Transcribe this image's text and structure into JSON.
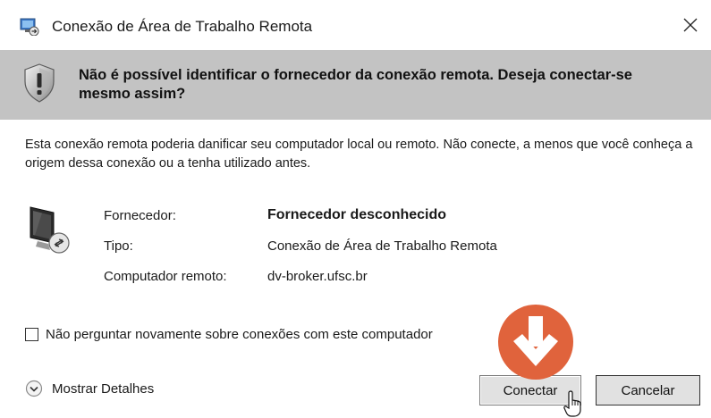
{
  "window": {
    "title": "Conexão de Área de Trabalho Remota",
    "close_glyph": "✕",
    "icon": "remote-desktop-icon"
  },
  "warning": {
    "icon": "shield-warning-icon",
    "text": "Não é possível identificar o fornecedor da conexão remota. Deseja conectar-se mesmo assim?"
  },
  "description": "Esta conexão remota poderia danificar seu computador local ou remoto. Não conecte, a menos que você conheça a origem dessa conexão ou a tenha utilizado antes.",
  "info": {
    "icon": "remote-computer-icon",
    "rows": [
      {
        "label": "Fornecedor:",
        "value": "Fornecedor desconhecido"
      },
      {
        "label": "Tipo:",
        "value": "Conexão de Área de Trabalho Remota"
      },
      {
        "label": "Computador remoto:",
        "value": "dv-broker.ufsc.br"
      }
    ]
  },
  "checkbox": {
    "label": "Não perguntar novamente sobre conexões com este computador",
    "checked": false
  },
  "details": {
    "label": "Mostrar Detalhes",
    "icon": "chevron-down-circle-icon"
  },
  "buttons": {
    "connect": "Conectar",
    "cancel": "Cancelar"
  },
  "colors": {
    "warning_band": "#c3c3c3",
    "badge": "#e0633c"
  }
}
